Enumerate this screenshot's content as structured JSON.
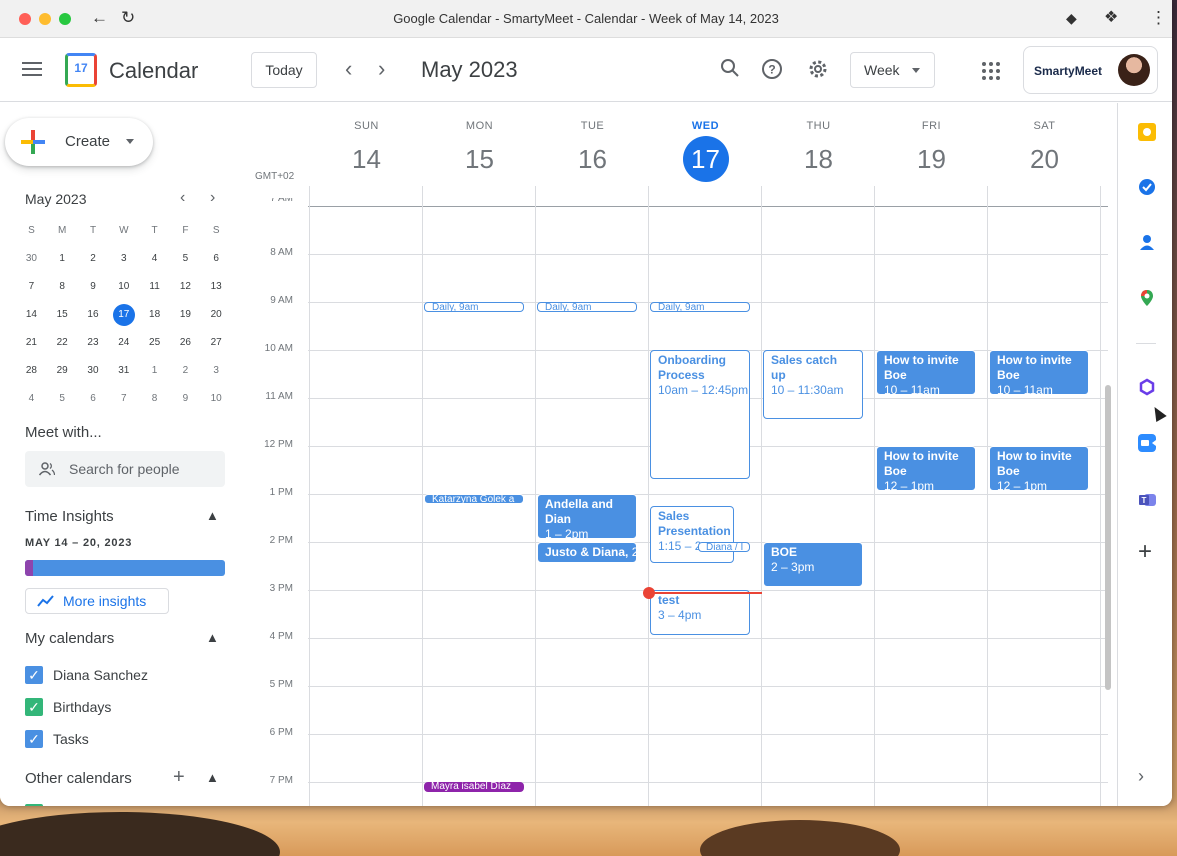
{
  "window": {
    "title": "Google Calendar - SmartyMeet - Calendar - Week of May 14, 2023"
  },
  "header": {
    "app_name": "Calendar",
    "logo_day": "17",
    "today_label": "Today",
    "current_month": "May 2023",
    "view_label": "Week",
    "account_brand": "SmartyMeet"
  },
  "sidebar": {
    "create_label": "Create",
    "mini_title": "May 2023",
    "mini_headers": [
      "S",
      "M",
      "T",
      "W",
      "T",
      "F",
      "S"
    ],
    "mini_weeks": [
      [
        "30",
        "1",
        "2",
        "3",
        "4",
        "5",
        "6"
      ],
      [
        "7",
        "8",
        "9",
        "10",
        "11",
        "12",
        "13"
      ],
      [
        "14",
        "15",
        "16",
        "17",
        "18",
        "19",
        "20"
      ],
      [
        "21",
        "22",
        "23",
        "24",
        "25",
        "26",
        "27"
      ],
      [
        "28",
        "29",
        "30",
        "31",
        "1",
        "2",
        "3"
      ],
      [
        "4",
        "5",
        "6",
        "7",
        "8",
        "9",
        "10"
      ]
    ],
    "mini_selected": "17",
    "meet_title": "Meet with...",
    "search_placeholder": "Search for people",
    "insights_title": "Time Insights",
    "insights_range": "MAY 14 – 20, 2023",
    "insights_purple_fraction": 0.04,
    "more_insights": "More insights",
    "my_calendars_title": "My calendars",
    "calendars": [
      {
        "name": "Diana Sanchez",
        "color": "#4a90e2"
      },
      {
        "name": "Birthdays",
        "color": "#33b679"
      },
      {
        "name": "Tasks",
        "color": "#4a90e2"
      }
    ],
    "other_calendars_title": "Other calendars"
  },
  "week": {
    "timezone": "GMT+02",
    "days": [
      {
        "name": "SUN",
        "date": "14"
      },
      {
        "name": "MON",
        "date": "15"
      },
      {
        "name": "TUE",
        "date": "16"
      },
      {
        "name": "WED",
        "date": "17",
        "today": true
      },
      {
        "name": "THU",
        "date": "18"
      },
      {
        "name": "FRI",
        "date": "19"
      },
      {
        "name": "SAT",
        "date": "20"
      }
    ],
    "hours": [
      "7 AM",
      "8 AM",
      "9 AM",
      "10 AM",
      "11 AM",
      "12 PM",
      "1 PM",
      "2 PM",
      "3 PM",
      "4 PM",
      "5 PM",
      "6 PM",
      "7 PM"
    ]
  },
  "events": [
    {
      "title": "Daily, 9am",
      "time": "",
      "day": 1,
      "start": 9,
      "end": 9.25,
      "style": "o"
    },
    {
      "title": "Daily, 9am",
      "time": "",
      "day": 2,
      "start": 9,
      "end": 9.25,
      "style": "o"
    },
    {
      "title": "Daily, 9am",
      "time": "",
      "day": 3,
      "start": 9,
      "end": 9.25,
      "style": "o"
    },
    {
      "title": "Onboarding Process",
      "time": "10am – 12:45pm",
      "day": 3,
      "start": 10,
      "end": 12.75,
      "style": "o"
    },
    {
      "title": "Sales catch up",
      "time": "10 – 11:30am",
      "day": 4,
      "start": 10,
      "end": 11.5,
      "style": "o"
    },
    {
      "title": "How to invite Boe",
      "time": "10 – 11am",
      "day": 5,
      "start": 10,
      "end": 11,
      "style": "f"
    },
    {
      "title": "How to invite Boe",
      "time": "10 – 11am",
      "day": 6,
      "start": 10,
      "end": 11,
      "style": "f"
    },
    {
      "title": "How to invite Boe",
      "time": "12 – 1pm",
      "day": 5,
      "start": 12,
      "end": 13,
      "style": "f"
    },
    {
      "title": "How to invite Boe",
      "time": "12 – 1pm",
      "day": 6,
      "start": 12,
      "end": 13,
      "style": "f"
    },
    {
      "title": "Katarzyna Golek a",
      "time": "",
      "day": 1,
      "start": 13,
      "end": 13.25,
      "style": "f"
    },
    {
      "title": "Andella and Dian",
      "time": "1 – 2pm",
      "day": 2,
      "start": 13,
      "end": 14,
      "style": "f"
    },
    {
      "title": "Sales Presentation",
      "time": "1:15 – 2",
      "day": 3,
      "start": 13.25,
      "end": 14.5,
      "style": "o",
      "narrow": true
    },
    {
      "title": "Diana / I",
      "time": "",
      "day": 3,
      "start": 14,
      "end": 14.25,
      "style": "o",
      "offset": true
    },
    {
      "title": "Justo & Diana,",
      "time": "2p",
      "day": 2,
      "start": 14,
      "end": 14.5,
      "style": "f",
      "inline": true
    },
    {
      "title": "BOE",
      "time": "2 – 3pm",
      "day": 4,
      "start": 14,
      "end": 15,
      "style": "f"
    },
    {
      "title": "test",
      "time": "3 – 4pm",
      "day": 3,
      "start": 15,
      "end": 16,
      "style": "o"
    },
    {
      "title": "Mayra isabel Díaz",
      "time": "",
      "day": 1,
      "start": 19,
      "end": 19.25,
      "style": "p"
    }
  ],
  "now": {
    "day": 3,
    "hour": 15.05
  }
}
